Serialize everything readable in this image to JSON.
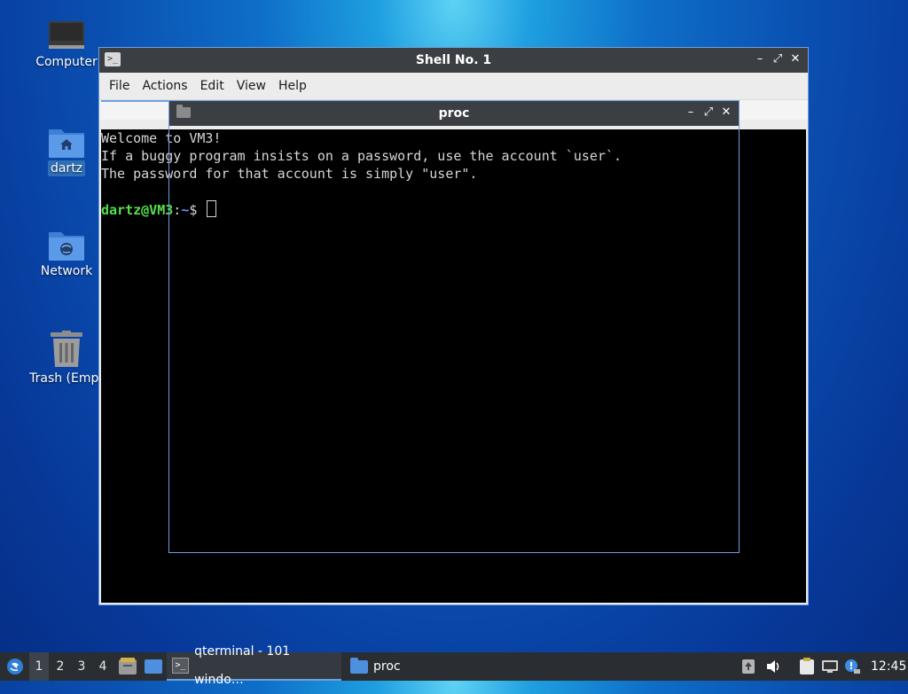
{
  "desktop": {
    "icons": [
      {
        "label": "Computer"
      },
      {
        "label": "dartz"
      },
      {
        "label": "Network"
      },
      {
        "label": "Trash (Empt"
      }
    ]
  },
  "main_window": {
    "title": "Shell No. 1",
    "title_icon": ">_",
    "menu": [
      "File",
      "Actions",
      "Edit",
      "View",
      "Help"
    ],
    "controls": {
      "minimize": "–",
      "maximize": "⤢",
      "close": "✕"
    },
    "terminal": {
      "lines": [
        "Welcome to VM3!",
        "If a buggy program insists on a password, use the account `user`.",
        "The password for that account is simply \"user\".",
        ""
      ],
      "prompt_user": "dartz@VM3",
      "prompt_colon": ":",
      "prompt_path": "~",
      "prompt_symbol": "$ "
    }
  },
  "proc_window": {
    "title": "proc",
    "controls": {
      "minimize": "–",
      "maximize": "⤢",
      "close": "✕"
    }
  },
  "taskbar": {
    "workspaces": [
      "1",
      "2",
      "3",
      "4"
    ],
    "active_workspace": "1",
    "tasks": [
      {
        "label": "qterminal - 101 windo…",
        "icon": "terminal-icon"
      },
      {
        "label": "proc",
        "icon": "folder-icon"
      }
    ],
    "clock": "12:45"
  },
  "colors": {
    "accent": "#6fa0dd",
    "titlebar": "#3b3f44",
    "prompt_user": "#55e04a",
    "prompt_path": "#6b8cff"
  }
}
